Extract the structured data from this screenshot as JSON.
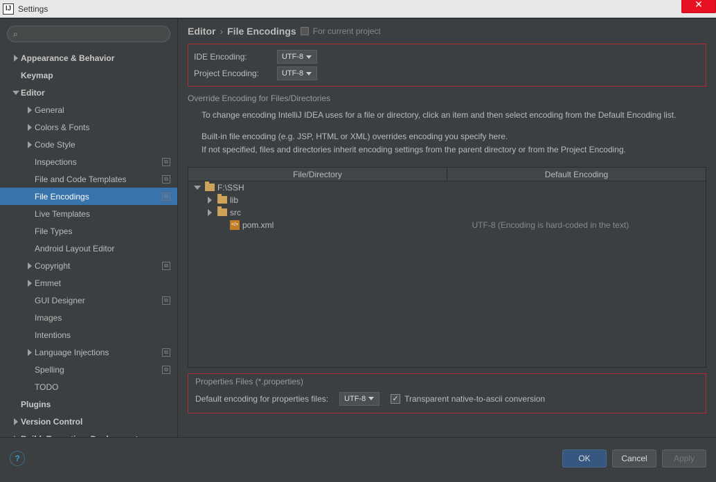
{
  "titlebar": {
    "title": "Settings"
  },
  "search": {
    "placeholder": ""
  },
  "sidebar": {
    "nodes": [
      {
        "label": "Appearance & Behavior",
        "depth": 0,
        "arrow": "right",
        "bold": true
      },
      {
        "label": "Keymap",
        "depth": 0,
        "arrow": "",
        "bold": true
      },
      {
        "label": "Editor",
        "depth": 0,
        "arrow": "down",
        "bold": true
      },
      {
        "label": "General",
        "depth": 1,
        "arrow": "right"
      },
      {
        "label": "Colors & Fonts",
        "depth": 1,
        "arrow": "right"
      },
      {
        "label": "Code Style",
        "depth": 1,
        "arrow": "right"
      },
      {
        "label": "Inspections",
        "depth": 1,
        "arrow": "",
        "badge": true
      },
      {
        "label": "File and Code Templates",
        "depth": 1,
        "arrow": "",
        "badge": true
      },
      {
        "label": "File Encodings",
        "depth": 1,
        "arrow": "",
        "badge": true,
        "selected": true
      },
      {
        "label": "Live Templates",
        "depth": 1,
        "arrow": ""
      },
      {
        "label": "File Types",
        "depth": 1,
        "arrow": ""
      },
      {
        "label": "Android Layout Editor",
        "depth": 1,
        "arrow": ""
      },
      {
        "label": "Copyright",
        "depth": 1,
        "arrow": "right",
        "badge": true
      },
      {
        "label": "Emmet",
        "depth": 1,
        "arrow": "right"
      },
      {
        "label": "GUI Designer",
        "depth": 1,
        "arrow": "",
        "badge": true
      },
      {
        "label": "Images",
        "depth": 1,
        "arrow": ""
      },
      {
        "label": "Intentions",
        "depth": 1,
        "arrow": ""
      },
      {
        "label": "Language Injections",
        "depth": 1,
        "arrow": "right",
        "badge": true
      },
      {
        "label": "Spelling",
        "depth": 1,
        "arrow": "",
        "badge": true
      },
      {
        "label": "TODO",
        "depth": 1,
        "arrow": ""
      },
      {
        "label": "Plugins",
        "depth": 0,
        "arrow": "",
        "bold": true
      },
      {
        "label": "Version Control",
        "depth": 0,
        "arrow": "right",
        "bold": true
      },
      {
        "label": "Build, Execution, Deployment",
        "depth": 0,
        "arrow": "right",
        "bold": true
      }
    ]
  },
  "breadcrumb": {
    "a": "Editor",
    "b": "File Encodings",
    "proj": "For current project"
  },
  "encGroup": {
    "ideLabel": "IDE Encoding:",
    "ideValue": "UTF-8",
    "projLabel": "Project Encoding:",
    "projValue": "UTF-8"
  },
  "override": {
    "title": "Override Encoding for Files/Directories",
    "p1": "To change encoding IntelliJ IDEA uses for a file or directory, click an item and then select encoding from the Default Encoding list.",
    "p2a": "Built-in file encoding (e.g. JSP, HTML or XML) overrides encoding you specify here.",
    "p2b": "If not specified, files and directories inherit encoding settings from the parent directory or from the Project Encoding."
  },
  "table": {
    "h1": "File/Directory",
    "h2": "Default Encoding",
    "rows": [
      {
        "indent": 0,
        "arrow": "down",
        "icon": "folder",
        "name": "F:\\SSH",
        "right": ""
      },
      {
        "indent": 1,
        "arrow": "right",
        "icon": "folder",
        "name": "lib",
        "right": ""
      },
      {
        "indent": 1,
        "arrow": "right",
        "icon": "folder",
        "name": "src",
        "right": ""
      },
      {
        "indent": 2,
        "arrow": "",
        "icon": "xml",
        "name": "pom.xml",
        "right": "UTF-8 (Encoding is hard-coded in the text)"
      }
    ]
  },
  "props": {
    "title": "Properties Files (*.properties)",
    "label": "Default encoding for properties files:",
    "value": "UTF-8",
    "cbLabel": "Transparent native-to-ascii conversion",
    "cbChecked": true
  },
  "buttons": {
    "ok": "OK",
    "cancel": "Cancel",
    "apply": "Apply"
  }
}
